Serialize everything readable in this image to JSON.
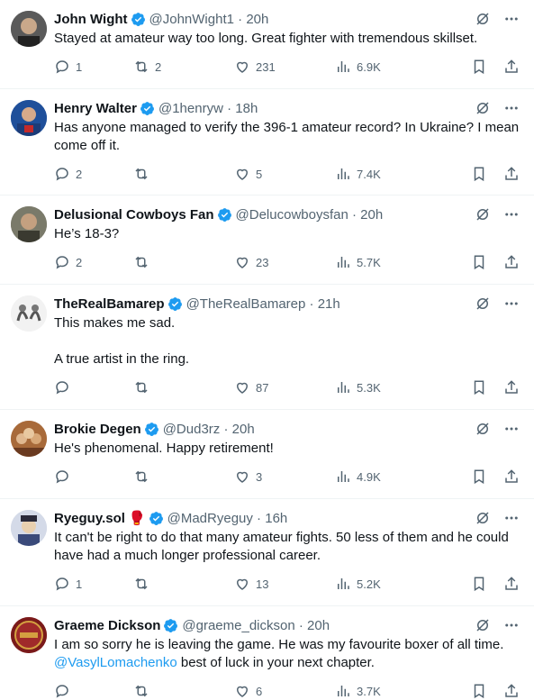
{
  "tweets": [
    {
      "name": "John Wight",
      "handle": "@JohnWight1",
      "time": "20h",
      "text": "Stayed at amateur way too long. Great fighter with tremendous skillset.",
      "replies": "1",
      "retweets": "2",
      "likes": "231",
      "views": "6.9K",
      "avatar_color": "#4a4a4a"
    },
    {
      "name": "Henry Walter",
      "handle": "@1henryw",
      "time": "18h",
      "text": "Has anyone managed to verify the 396-1 amateur record? In Ukraine? I mean come off it.",
      "replies": "2",
      "retweets": "",
      "likes": "5",
      "views": "7.4K",
      "avatar_color": "#2b5aa0"
    },
    {
      "name": "Delusional Cowboys Fan",
      "handle": "@Delucowboysfan",
      "time": "20h",
      "text": "He’s 18-3?",
      "replies": "2",
      "retweets": "",
      "likes": "23",
      "views": "5.7K",
      "avatar_color": "#6b6b5e"
    },
    {
      "name": "TheRealBamarep",
      "handle": "@TheRealBamarep",
      "time": "21h",
      "text": "This makes me sad.\n\nA true artist in the ring.",
      "replies": "",
      "retweets": "",
      "likes": "87",
      "views": "5.3K",
      "avatar_color": "#d9d9d9"
    },
    {
      "name": "Brokie Degen",
      "handle": "@Dud3rz",
      "time": "20h",
      "text": "He's phenomenal. Happy retirement!",
      "replies": "",
      "retweets": "",
      "likes": "3",
      "views": "4.9K",
      "avatar_color": "#b07040"
    },
    {
      "name": "Ryeguy.sol",
      "handle": "@MadRyeguy",
      "time": "16h",
      "text": "It can't be right to do that many amateur fights. 50 less of them and he could have had a much longer professional career.",
      "replies": "1",
      "retweets": "",
      "likes": "13",
      "views": "5.2K",
      "avatar_color": "#c8d0e0",
      "emoji": "🥊"
    },
    {
      "name": "Graeme Dickson",
      "handle": "@graeme_dickson",
      "time": "20h",
      "text_before": "I am so sorry he is leaving the game. He was my favourite boxer of all time.",
      "mention": "@VasylLomachenko",
      "text_after": " best of luck in your next chapter.",
      "replies": "",
      "retweets": "",
      "likes": "6",
      "views": "3.7K",
      "avatar_color": "#8a2020"
    }
  ],
  "colors": {
    "verified": "#1d9bf0",
    "muted": "#536471",
    "text": "#0f1419",
    "link": "#1d9bf0"
  }
}
